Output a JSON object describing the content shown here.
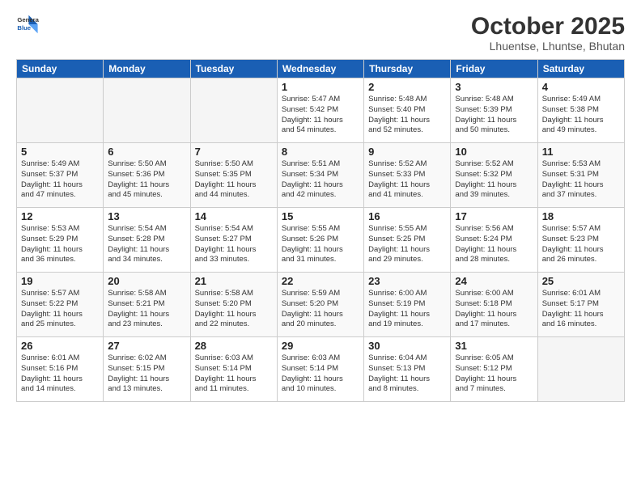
{
  "logo": {
    "line1": "General",
    "line2": "Blue"
  },
  "title": "October 2025",
  "subtitle": "Lhuentse, Lhuntse, Bhutan",
  "days_of_week": [
    "Sunday",
    "Monday",
    "Tuesday",
    "Wednesday",
    "Thursday",
    "Friday",
    "Saturday"
  ],
  "weeks": [
    [
      {
        "day": "",
        "info": ""
      },
      {
        "day": "",
        "info": ""
      },
      {
        "day": "",
        "info": ""
      },
      {
        "day": "1",
        "info": "Sunrise: 5:47 AM\nSunset: 5:42 PM\nDaylight: 11 hours\nand 54 minutes."
      },
      {
        "day": "2",
        "info": "Sunrise: 5:48 AM\nSunset: 5:40 PM\nDaylight: 11 hours\nand 52 minutes."
      },
      {
        "day": "3",
        "info": "Sunrise: 5:48 AM\nSunset: 5:39 PM\nDaylight: 11 hours\nand 50 minutes."
      },
      {
        "day": "4",
        "info": "Sunrise: 5:49 AM\nSunset: 5:38 PM\nDaylight: 11 hours\nand 49 minutes."
      }
    ],
    [
      {
        "day": "5",
        "info": "Sunrise: 5:49 AM\nSunset: 5:37 PM\nDaylight: 11 hours\nand 47 minutes."
      },
      {
        "day": "6",
        "info": "Sunrise: 5:50 AM\nSunset: 5:36 PM\nDaylight: 11 hours\nand 45 minutes."
      },
      {
        "day": "7",
        "info": "Sunrise: 5:50 AM\nSunset: 5:35 PM\nDaylight: 11 hours\nand 44 minutes."
      },
      {
        "day": "8",
        "info": "Sunrise: 5:51 AM\nSunset: 5:34 PM\nDaylight: 11 hours\nand 42 minutes."
      },
      {
        "day": "9",
        "info": "Sunrise: 5:52 AM\nSunset: 5:33 PM\nDaylight: 11 hours\nand 41 minutes."
      },
      {
        "day": "10",
        "info": "Sunrise: 5:52 AM\nSunset: 5:32 PM\nDaylight: 11 hours\nand 39 minutes."
      },
      {
        "day": "11",
        "info": "Sunrise: 5:53 AM\nSunset: 5:31 PM\nDaylight: 11 hours\nand 37 minutes."
      }
    ],
    [
      {
        "day": "12",
        "info": "Sunrise: 5:53 AM\nSunset: 5:29 PM\nDaylight: 11 hours\nand 36 minutes."
      },
      {
        "day": "13",
        "info": "Sunrise: 5:54 AM\nSunset: 5:28 PM\nDaylight: 11 hours\nand 34 minutes."
      },
      {
        "day": "14",
        "info": "Sunrise: 5:54 AM\nSunset: 5:27 PM\nDaylight: 11 hours\nand 33 minutes."
      },
      {
        "day": "15",
        "info": "Sunrise: 5:55 AM\nSunset: 5:26 PM\nDaylight: 11 hours\nand 31 minutes."
      },
      {
        "day": "16",
        "info": "Sunrise: 5:55 AM\nSunset: 5:25 PM\nDaylight: 11 hours\nand 29 minutes."
      },
      {
        "day": "17",
        "info": "Sunrise: 5:56 AM\nSunset: 5:24 PM\nDaylight: 11 hours\nand 28 minutes."
      },
      {
        "day": "18",
        "info": "Sunrise: 5:57 AM\nSunset: 5:23 PM\nDaylight: 11 hours\nand 26 minutes."
      }
    ],
    [
      {
        "day": "19",
        "info": "Sunrise: 5:57 AM\nSunset: 5:22 PM\nDaylight: 11 hours\nand 25 minutes."
      },
      {
        "day": "20",
        "info": "Sunrise: 5:58 AM\nSunset: 5:21 PM\nDaylight: 11 hours\nand 23 minutes."
      },
      {
        "day": "21",
        "info": "Sunrise: 5:58 AM\nSunset: 5:20 PM\nDaylight: 11 hours\nand 22 minutes."
      },
      {
        "day": "22",
        "info": "Sunrise: 5:59 AM\nSunset: 5:20 PM\nDaylight: 11 hours\nand 20 minutes."
      },
      {
        "day": "23",
        "info": "Sunrise: 6:00 AM\nSunset: 5:19 PM\nDaylight: 11 hours\nand 19 minutes."
      },
      {
        "day": "24",
        "info": "Sunrise: 6:00 AM\nSunset: 5:18 PM\nDaylight: 11 hours\nand 17 minutes."
      },
      {
        "day": "25",
        "info": "Sunrise: 6:01 AM\nSunset: 5:17 PM\nDaylight: 11 hours\nand 16 minutes."
      }
    ],
    [
      {
        "day": "26",
        "info": "Sunrise: 6:01 AM\nSunset: 5:16 PM\nDaylight: 11 hours\nand 14 minutes."
      },
      {
        "day": "27",
        "info": "Sunrise: 6:02 AM\nSunset: 5:15 PM\nDaylight: 11 hours\nand 13 minutes."
      },
      {
        "day": "28",
        "info": "Sunrise: 6:03 AM\nSunset: 5:14 PM\nDaylight: 11 hours\nand 11 minutes."
      },
      {
        "day": "29",
        "info": "Sunrise: 6:03 AM\nSunset: 5:14 PM\nDaylight: 11 hours\nand 10 minutes."
      },
      {
        "day": "30",
        "info": "Sunrise: 6:04 AM\nSunset: 5:13 PM\nDaylight: 11 hours\nand 8 minutes."
      },
      {
        "day": "31",
        "info": "Sunrise: 6:05 AM\nSunset: 5:12 PM\nDaylight: 11 hours\nand 7 minutes."
      },
      {
        "day": "",
        "info": ""
      }
    ]
  ]
}
